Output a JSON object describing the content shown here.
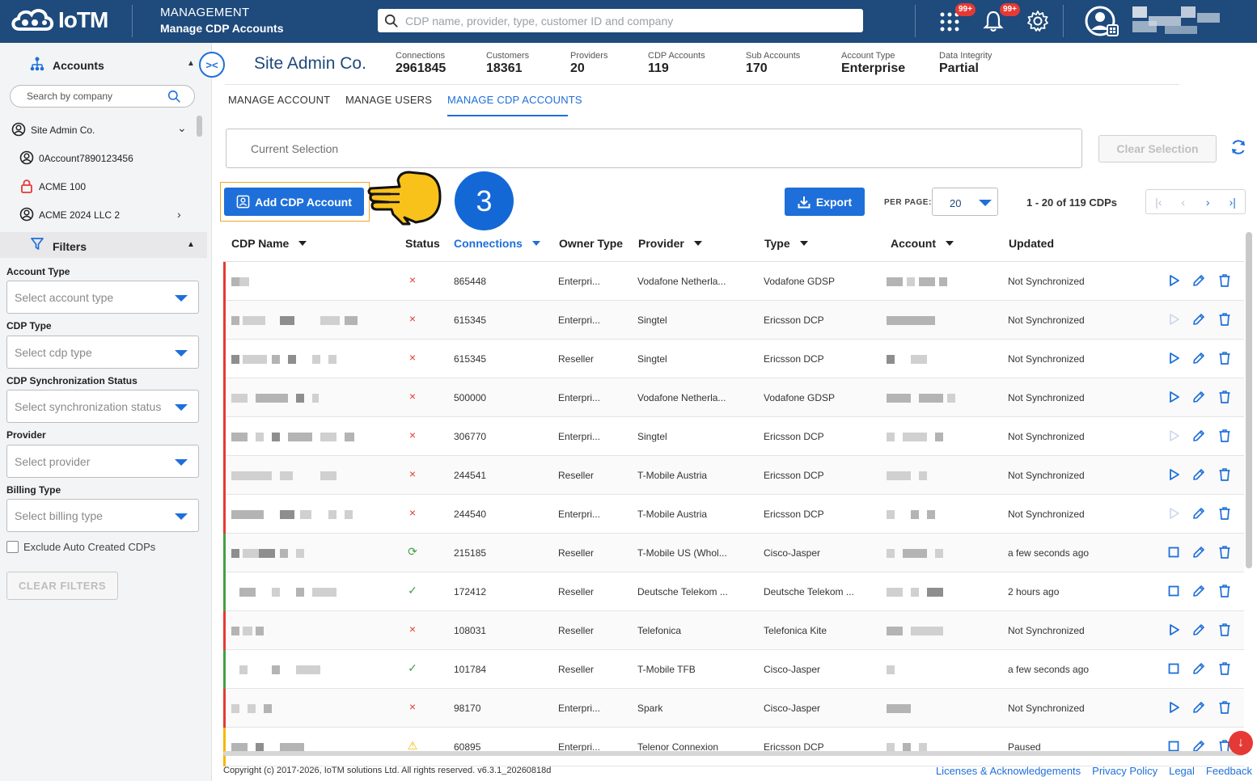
{
  "topbar": {
    "logo_text": "IoTM",
    "section_title": "MANAGEMENT",
    "section_subtitle": "Manage CDP Accounts",
    "search_placeholder": "CDP name, provider, type, customer ID and company",
    "apps_badge": "99+",
    "notifications_badge": "99+"
  },
  "sidebar": {
    "accounts_label": "Accounts",
    "search_placeholder": "Search by company",
    "tree": [
      {
        "label": "Site Admin Co.",
        "icon": "account-circle-icon",
        "chevron": "expand-more"
      },
      {
        "label": "0Account7890123456",
        "icon": "account-circle-icon"
      },
      {
        "label": "ACME 100",
        "icon": "lock-icon"
      },
      {
        "label": "ACME 2024 LLC 2",
        "icon": "account-circle-icon",
        "chevron": "chevron-right"
      }
    ],
    "filters_label": "Filters",
    "filters": [
      {
        "label": "Account Type",
        "placeholder": "Select account type"
      },
      {
        "label": "CDP Type",
        "placeholder": "Select cdp type"
      },
      {
        "label": "CDP Synchronization Status",
        "placeholder": "Select synchronization status"
      },
      {
        "label": "Provider",
        "placeholder": "Select provider"
      },
      {
        "label": "Billing Type",
        "placeholder": "Select billing type"
      }
    ],
    "exclude_label": "Exclude Auto Created CDPs",
    "clear_filters": "CLEAR FILTERS"
  },
  "header": {
    "company": "Site Admin Co.",
    "stats": [
      {
        "label": "Connections",
        "value": "2961845"
      },
      {
        "label": "Customers",
        "value": "18361"
      },
      {
        "label": "Providers",
        "value": "20"
      },
      {
        "label": "CDP Accounts",
        "value": "119"
      },
      {
        "label": "Sub Accounts",
        "value": "170"
      },
      {
        "label": "Account Type",
        "value": "Enterprise"
      },
      {
        "label": "Data Integrity",
        "value": "Partial"
      }
    ],
    "tabs": [
      "MANAGE ACCOUNT",
      "MANAGE USERS",
      "MANAGE CDP ACCOUNTS"
    ]
  },
  "toolbar": {
    "current_selection_placeholder": "Current Selection",
    "clear_selection": "Clear Selection",
    "add_label": "Add CDP Account",
    "step_number": "3",
    "export_label": "Export",
    "per_page_label": "PER PAGE:",
    "per_page_value": "20",
    "range_text": "1 - 20 of 119 CDPs"
  },
  "table": {
    "columns": [
      "CDP Name",
      "Status",
      "Connections",
      "Owner Type",
      "Provider",
      "Type",
      "Account",
      "Updated"
    ],
    "rows": [
      {
        "status": "error",
        "connections": "865448",
        "owner": "Enterpri...",
        "provider": "Vodafone Netherla...",
        "type": "Vodafone GDSP",
        "updated": "Not Synchronized",
        "action": "play",
        "bar": "#e53935"
      },
      {
        "status": "error",
        "connections": "615345",
        "owner": "Enterpri...",
        "provider": "Singtel",
        "type": "Ericsson DCP",
        "updated": "Not Synchronized",
        "action": "play-disabled",
        "bar": "#e53935"
      },
      {
        "status": "error",
        "connections": "615345",
        "owner": "Reseller",
        "provider": "Singtel",
        "type": "Ericsson DCP",
        "updated": "Not Synchronized",
        "action": "play",
        "bar": "#e53935"
      },
      {
        "status": "error",
        "connections": "500000",
        "owner": "Enterpri...",
        "provider": "Vodafone Netherla...",
        "type": "Vodafone GDSP",
        "updated": "Not Synchronized",
        "action": "play",
        "bar": "#e53935"
      },
      {
        "status": "error",
        "connections": "306770",
        "owner": "Enterpri...",
        "provider": "Singtel",
        "type": "Ericsson DCP",
        "updated": "Not Synchronized",
        "action": "play-disabled",
        "bar": "#e53935"
      },
      {
        "status": "error",
        "connections": "244541",
        "owner": "Reseller",
        "provider": "T-Mobile Austria",
        "type": "Ericsson DCP",
        "updated": "Not Synchronized",
        "action": "play",
        "bar": "#e53935"
      },
      {
        "status": "error",
        "connections": "244540",
        "owner": "Enterpri...",
        "provider": "T-Mobile Austria",
        "type": "Ericsson DCP",
        "updated": "Not Synchronized",
        "action": "play-disabled",
        "bar": "#e53935"
      },
      {
        "status": "sync",
        "connections": "215185",
        "owner": "Reseller",
        "provider": "T-Mobile US (Whol...",
        "type": "Cisco-Jasper",
        "updated": "a few seconds ago",
        "action": "stop",
        "bar": "#43a047"
      },
      {
        "status": "ok",
        "connections": "172412",
        "owner": "Reseller",
        "provider": "Deutsche Telekom ...",
        "type": "Deutsche Telekom ...",
        "updated": "2 hours ago",
        "action": "stop",
        "bar": "#43a047"
      },
      {
        "status": "error",
        "connections": "108031",
        "owner": "Reseller",
        "provider": "Telefonica",
        "type": "Telefonica Kite",
        "updated": "Not Synchronized",
        "action": "play",
        "bar": "#e53935"
      },
      {
        "status": "ok",
        "connections": "101784",
        "owner": "Reseller",
        "provider": "T-Mobile TFB",
        "type": "Cisco-Jasper",
        "updated": "a few seconds ago",
        "action": "stop",
        "bar": "#43a047"
      },
      {
        "status": "error",
        "connections": "98170",
        "owner": "Enterpri...",
        "provider": "Spark",
        "type": "Cisco-Jasper",
        "updated": "Not Synchronized",
        "action": "play",
        "bar": "#e53935"
      },
      {
        "status": "warn",
        "connections": "60895",
        "owner": "Enterpri...",
        "provider": "Telenor Connexion",
        "type": "Ericsson DCP",
        "updated": "Paused",
        "action": "stop",
        "bar": "#f5b800"
      }
    ]
  },
  "footer": {
    "copyright": "Copyright (c) 2017-2026, IoTM solutions Ltd. All rights reserved. v6.3.1_20260818d",
    "links": [
      "Licenses & Acknowledgements",
      "Privacy Policy",
      "Legal",
      "Feedback"
    ]
  },
  "colors": {
    "primary": "#1e6fd9",
    "header": "#1e4a7c",
    "error": "#e53935",
    "ok": "#43a047",
    "warn": "#f5b800"
  }
}
